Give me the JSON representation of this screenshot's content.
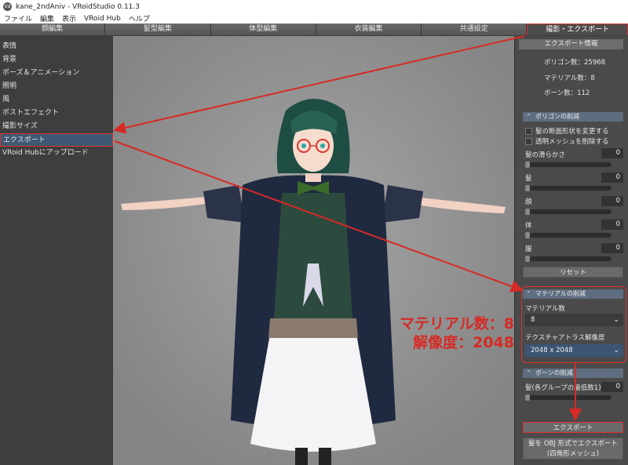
{
  "window": {
    "title": "kane_2ndAniv - VRoidStudio 0.11.3"
  },
  "menu": [
    "ファイル",
    "編集",
    "表示",
    "VRoid Hub",
    "ヘルプ"
  ],
  "tabs": [
    "顔編集",
    "髪型編集",
    "体型編集",
    "衣装編集",
    "共通設定",
    "撮影・エクスポート"
  ],
  "nav": [
    "表情",
    "背景",
    "ポーズ＆アニメーション",
    "照明",
    "風",
    "ポストエフェクト",
    "撮影サイズ",
    "エクスポート",
    "VRoid Hubにアップロード"
  ],
  "export_info": {
    "header": "エクスポート情報",
    "polygons": "ポリゴン数：25968",
    "materials": "マテリアル数：8",
    "bones": "ボーン数：112"
  },
  "polygon_reduction": {
    "header": "ポリゴンの削減",
    "check1": "髪の断面形状を変更する",
    "check2": "透明メッシュを削除する",
    "sliders": [
      {
        "label": "髪の滑らかさ",
        "value": "0"
      },
      {
        "label": "髪",
        "value": "0"
      },
      {
        "label": "顔",
        "value": "0"
      },
      {
        "label": "体",
        "value": "0"
      },
      {
        "label": "服",
        "value": "0"
      }
    ],
    "reset": "リセット"
  },
  "material_reduction": {
    "header": "マテリアルの削減",
    "count_label": "マテリアル数",
    "count_value": "8",
    "atlas_label": "テクスチャアトラス解像度",
    "atlas_value": "2048 x 2048"
  },
  "bone_reduction": {
    "header": "ボーンの削減",
    "label": "髪(各グループの最低数1)",
    "value": "0"
  },
  "buttons": {
    "export": "エクスポート",
    "obj_line1": "髪を OBJ 形式でエクスポート",
    "obj_line2": "(四角形メッシュ)"
  },
  "annotation": {
    "line1": "マテリアル数：8",
    "line2": "解像度：2048"
  },
  "colors": {
    "highlight_red": "#e0312c",
    "active_nav": "#3f5873",
    "viewport_bg": "#8e8e8e"
  }
}
